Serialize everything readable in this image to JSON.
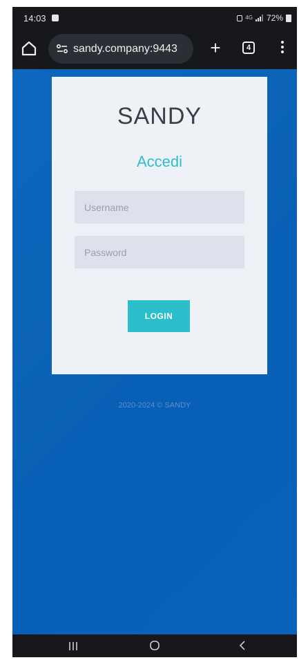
{
  "status_bar": {
    "time": "14:03",
    "network_label": "4G",
    "battery": "72%"
  },
  "browser": {
    "url": "sandy.company:9443",
    "tab_count": "4"
  },
  "login": {
    "brand": "SANDY",
    "title": "Accedi",
    "username_placeholder": "Username",
    "password_placeholder": "Password",
    "button_label": "LOGIN"
  },
  "footer": {
    "copyright": "2020-2024 © SANDY"
  },
  "colors": {
    "page_background": "#0b63b9",
    "accent": "#2bbfcc",
    "card": "#eef1f6",
    "field": "#dde1ec",
    "system_bars": "#16181c"
  },
  "icons": {
    "home": "home-icon",
    "site_info": "site-info-icon",
    "new_tab": "plus-icon",
    "tabs": "tab-switcher-icon",
    "menu": "more-vert-icon",
    "nav_recent": "recent-apps-icon",
    "nav_home": "nav-home-icon",
    "nav_back": "back-icon"
  }
}
